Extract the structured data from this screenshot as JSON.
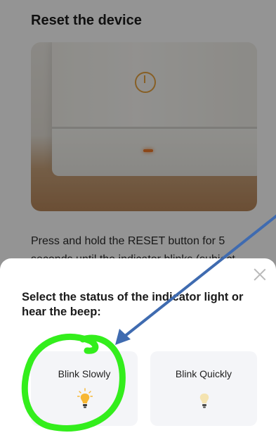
{
  "background": {
    "title": "Reset the device",
    "instruction_line1": "Press and hold the RESET button for 5",
    "instruction_line2": "seconds until the indicator blinks (subject"
  },
  "sheet": {
    "title": "Select the status of the indicator light or hear the beep:",
    "options": [
      {
        "label": "Blink Slowly",
        "icon": "bulb-lit-icon"
      },
      {
        "label": "Blink Quickly",
        "icon": "bulb-dim-icon"
      }
    ]
  },
  "colors": {
    "annotation_circle": "#33ee1c",
    "annotation_arrow": "#3f6bb0",
    "bulb_lit": "#f7b733",
    "bulb_dim": "#f4e3b0"
  }
}
